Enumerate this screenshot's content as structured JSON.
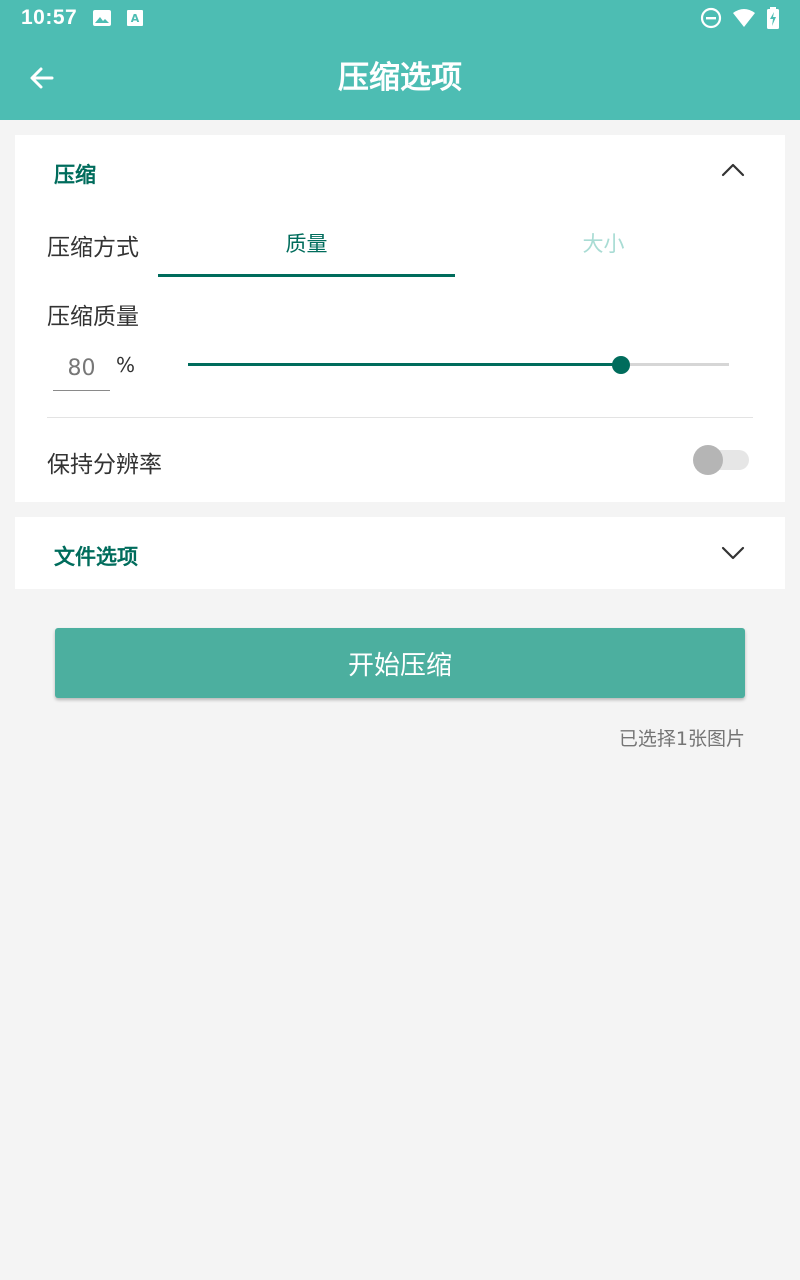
{
  "status_bar": {
    "time": "10:57",
    "left_icons": [
      "image-icon",
      "keyboard-a-icon"
    ],
    "right_icons": [
      "do-not-disturb-icon",
      "wifi-icon",
      "battery-charging-icon"
    ]
  },
  "toolbar": {
    "title": "压缩选项",
    "back_icon": "arrow-left-icon",
    "background_color": "#4dbdb3"
  },
  "compress_section": {
    "title": "压缩",
    "expanded": true,
    "method_label": "压缩方式",
    "tabs": [
      {
        "label": "质量",
        "selected": true
      },
      {
        "label": "大小",
        "selected": false
      }
    ],
    "quality_label": "压缩质量",
    "quality_value": "80",
    "quality_unit": "%",
    "slider_percent": 80,
    "keep_resolution_label": "保持分辨率",
    "keep_resolution_on": false
  },
  "file_section": {
    "title": "文件选项",
    "expanded": false
  },
  "actions": {
    "start_label": "开始压缩",
    "selected_count_text": "已选择1张图片"
  },
  "colors": {
    "accent": "#006c5c",
    "button": "#4caf9f",
    "inactive_tab": "#a9dcd4"
  }
}
